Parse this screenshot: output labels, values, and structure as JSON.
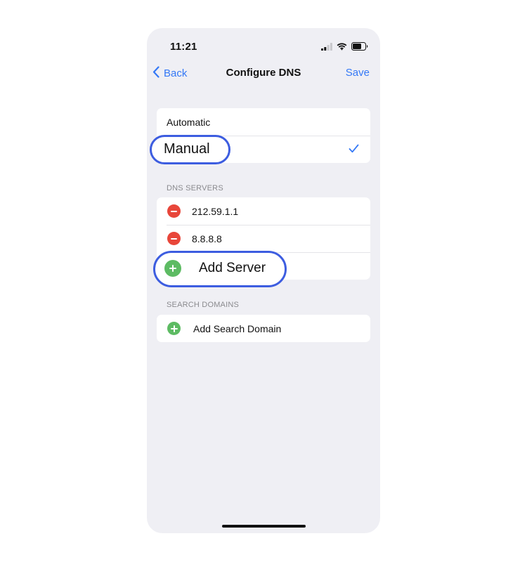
{
  "status_bar": {
    "time": "11:21",
    "icons": [
      "cellular-signal-icon",
      "wifi-icon",
      "battery-icon"
    ]
  },
  "nav": {
    "back_label": "Back",
    "title": "Configure DNS",
    "save_label": "Save"
  },
  "mode": {
    "options": [
      {
        "label": "Automatic",
        "selected": false
      },
      {
        "label": "Manual",
        "selected": true
      }
    ]
  },
  "dns_servers": {
    "header": "DNS SERVERS",
    "servers": [
      "212.59.1.1",
      "8.8.8.8"
    ],
    "add_label": "Add Server"
  },
  "search_domains": {
    "header": "SEARCH DOMAINS",
    "add_label": "Add Search Domain"
  },
  "colors": {
    "accent": "#3478f6",
    "delete": "#e8463a",
    "add": "#5dbb63",
    "highlight_outline": "#3d5de0"
  }
}
